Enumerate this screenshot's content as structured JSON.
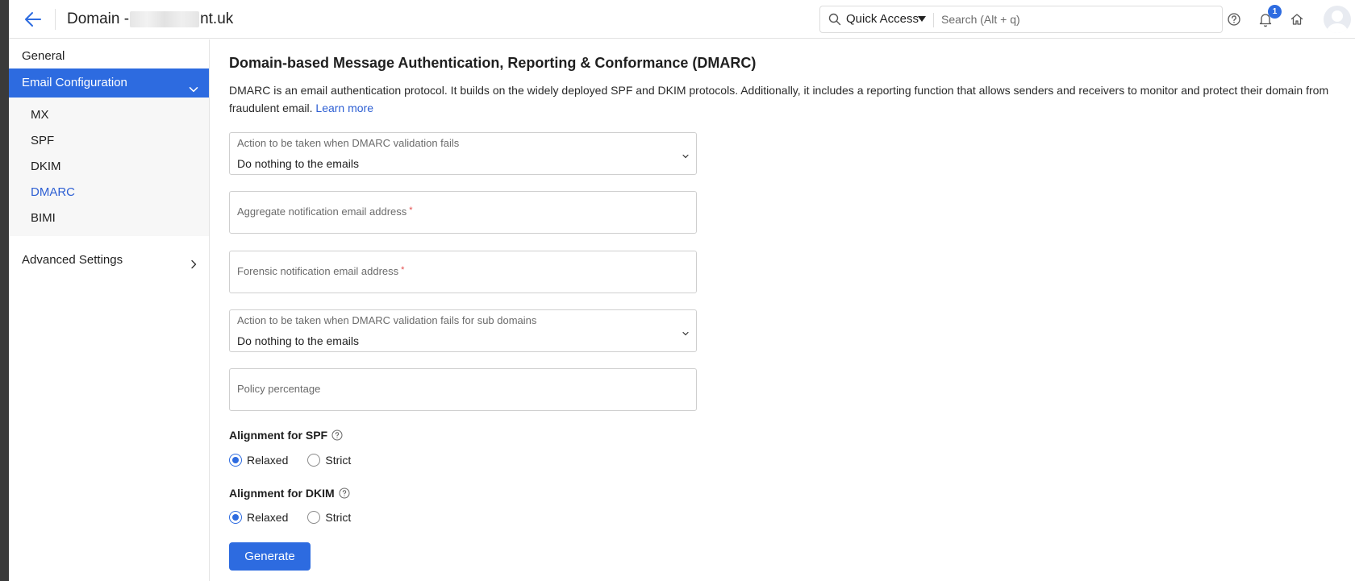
{
  "header": {
    "title_prefix": "Domain -",
    "title_suffix": "nt.uk",
    "quick_access_label": "Quick Access",
    "search_placeholder": "Search (Alt + q)",
    "notification_count": "1",
    "icons": [
      "back-arrow-icon",
      "search-icon",
      "caret-down-icon",
      "help-icon",
      "bell-icon",
      "home-icon",
      "avatar"
    ]
  },
  "sidebar": {
    "general_label": "General",
    "email_config_label": "Email Configuration",
    "sub_items": [
      {
        "label": "MX"
      },
      {
        "label": "SPF"
      },
      {
        "label": "DKIM"
      },
      {
        "label": "DMARC"
      },
      {
        "label": "BIMI"
      }
    ],
    "selected_sub_item": "DMARC",
    "advanced_label": "Advanced Settings"
  },
  "main": {
    "heading": "Domain-based Message Authentication, Reporting & Conformance (DMARC)",
    "description": "DMARC is an email authentication protocol. It builds on the widely deployed SPF and DKIM protocols. Additionally, it includes a reporting function that allows senders and receivers to monitor and protect their domain from fraudulent email.",
    "learn_more": "Learn more",
    "fields": {
      "action_label": "Action to be taken when DMARC validation fails",
      "action_value": "Do nothing to the emails",
      "aggregate_label": "Aggregate notification email address",
      "forensic_label": "Forensic notification email address",
      "required_mark": "*",
      "sub_action_label": "Action to be taken when DMARC validation fails for sub domains",
      "sub_action_value": "Do nothing to the emails",
      "policy_label": "Policy percentage"
    },
    "spf_alignment": {
      "label": "Alignment for SPF",
      "options": [
        "Relaxed",
        "Strict"
      ],
      "selected": "Relaxed"
    },
    "dkim_alignment": {
      "label": "Alignment for DKIM",
      "options": [
        "Relaxed",
        "Strict"
      ],
      "selected": "Relaxed"
    },
    "generate_label": "Generate"
  },
  "colors": {
    "accent": "#2d6be0",
    "link": "#2d5fd3",
    "required": "#e34b4b",
    "sub_panel_bg": "#f7f7f7"
  }
}
